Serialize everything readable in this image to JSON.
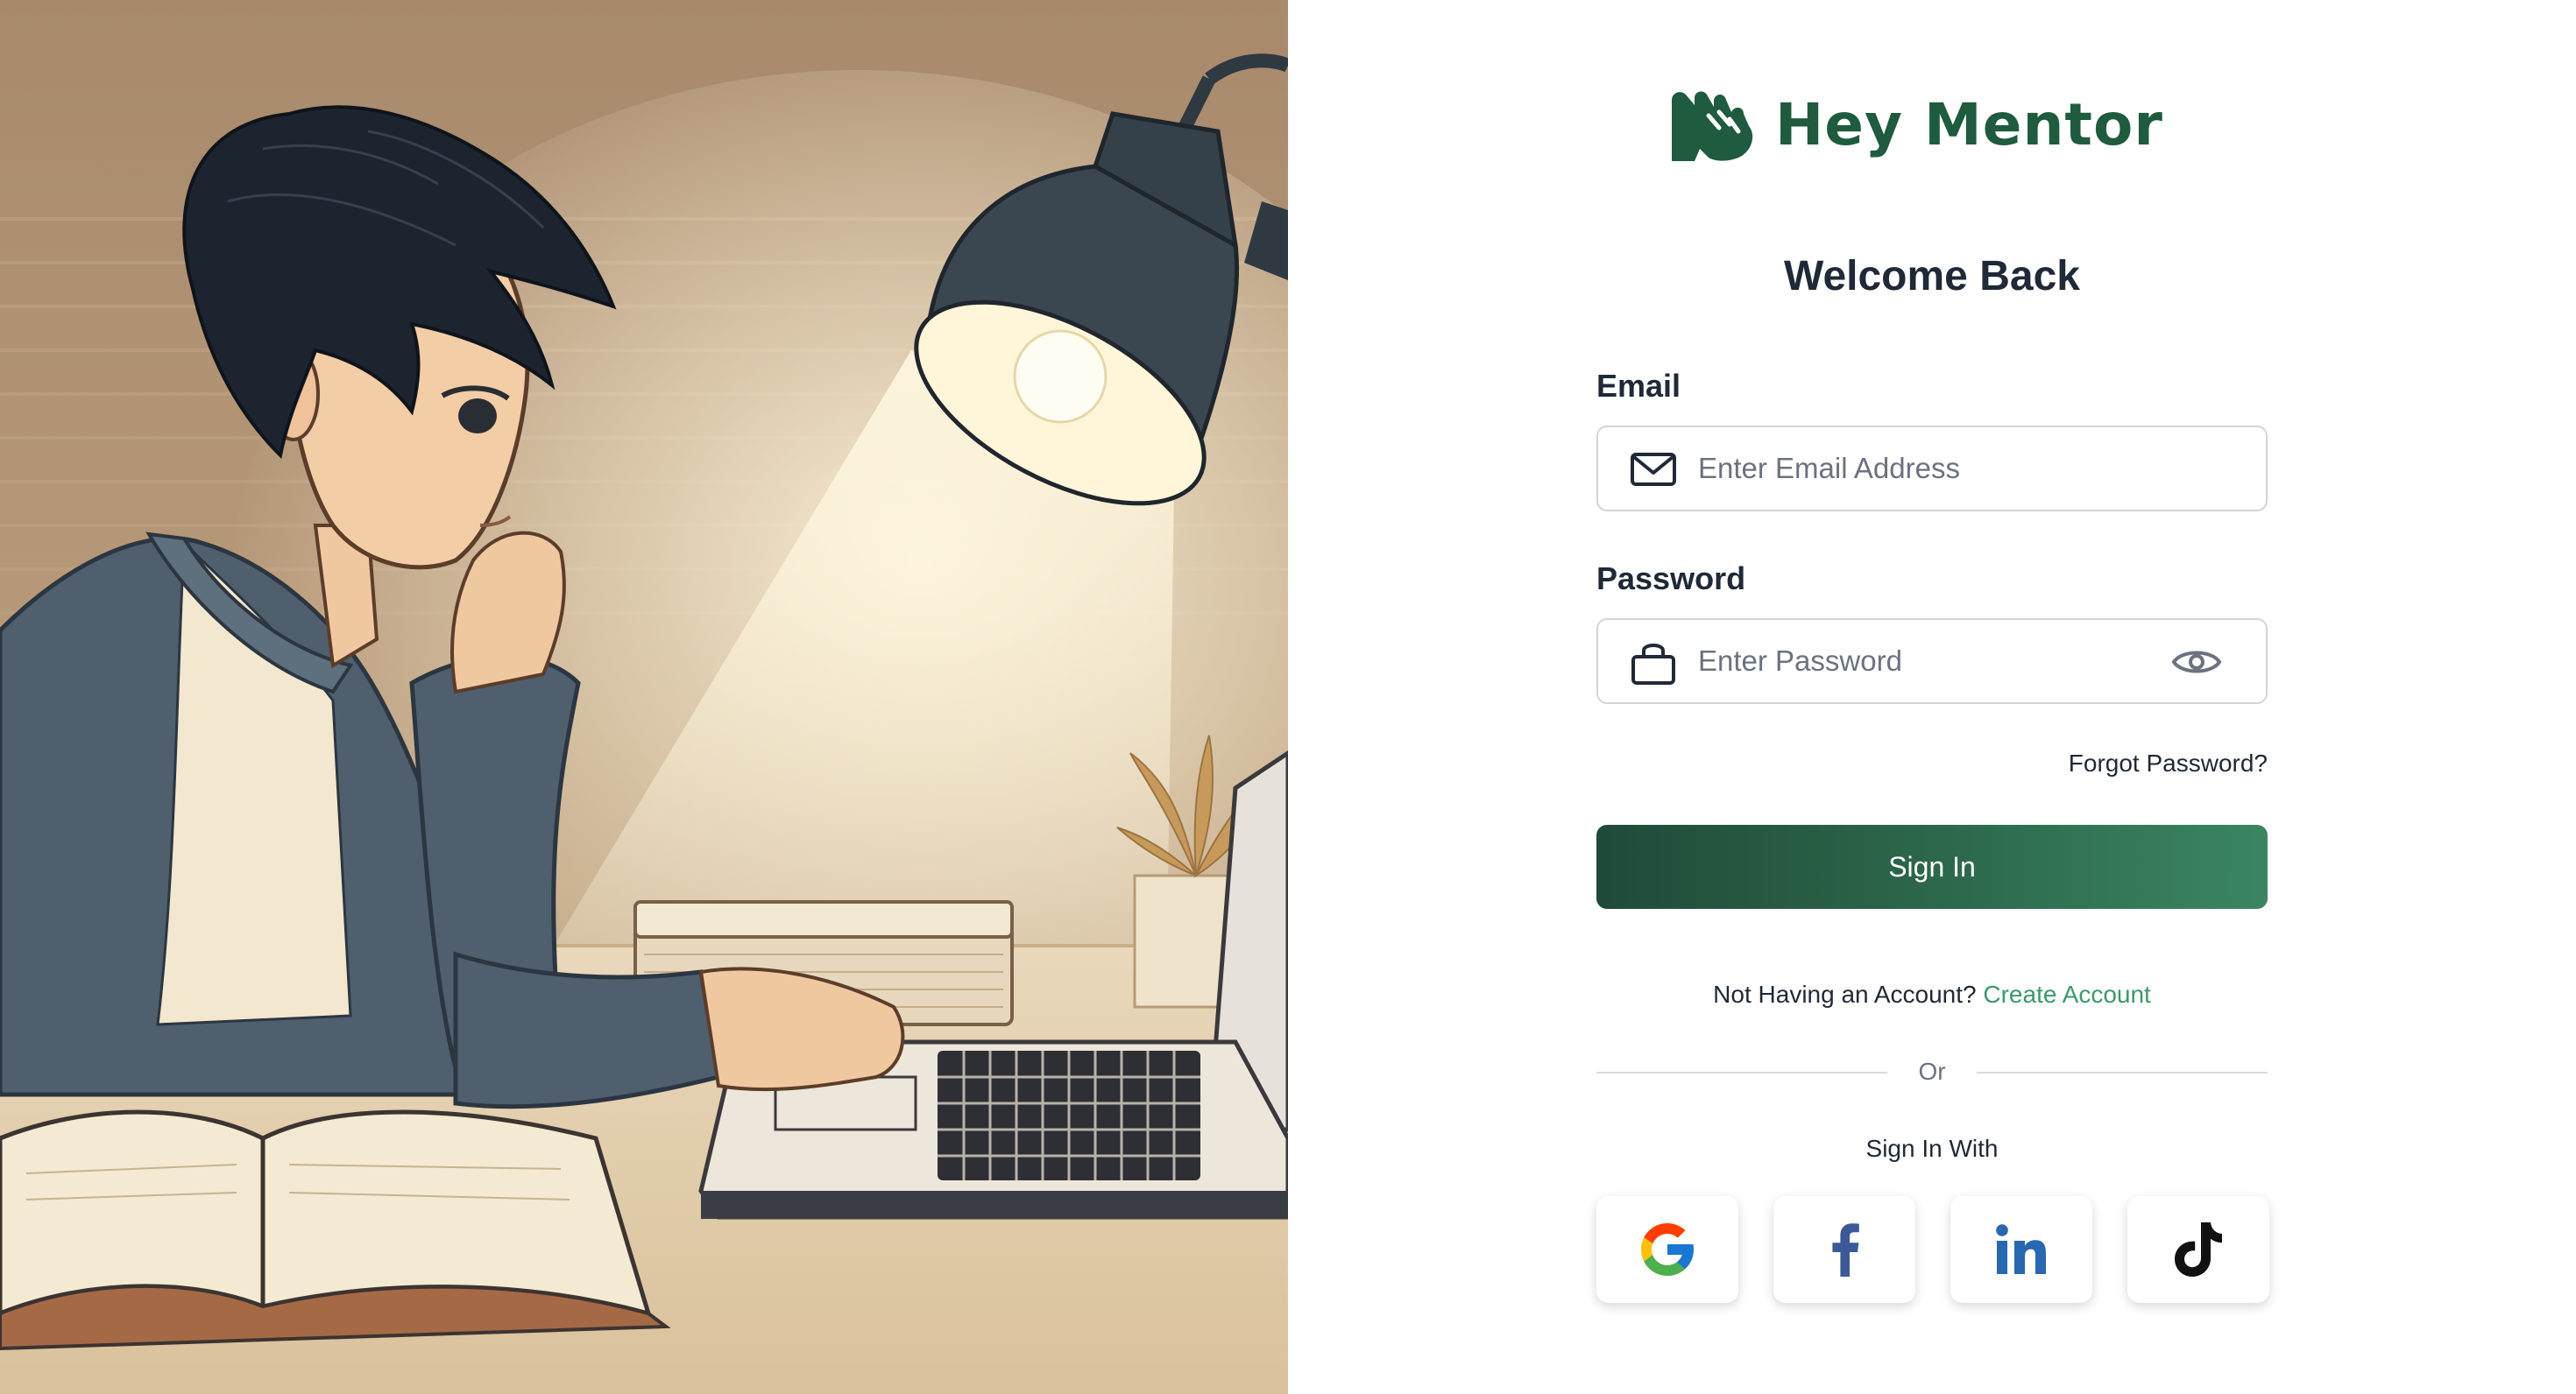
{
  "brand": {
    "name": "Hey Mentor",
    "color": "#1e5b3f",
    "icon": "hand-logo-icon"
  },
  "form": {
    "title": "Welcome Back",
    "email": {
      "label": "Email",
      "placeholder": "Enter Email Address",
      "value": "",
      "icon": "mail-icon"
    },
    "password": {
      "label": "Password",
      "placeholder": "Enter Password",
      "value": "",
      "icon": "lock-icon",
      "toggle_icon": "eye-icon"
    },
    "forgot_label": "Forgot Password?",
    "submit_label": "Sign In",
    "account_prompt": "Not Having an Account?",
    "create_account_label": "Create Account",
    "divider_label": "Or",
    "social_heading": "Sign In With"
  },
  "social": [
    {
      "name": "google",
      "icon": "google-icon"
    },
    {
      "name": "facebook",
      "icon": "facebook-icon"
    },
    {
      "name": "linkedin",
      "icon": "linkedin-icon"
    },
    {
      "name": "tiktok",
      "icon": "tiktok-icon"
    }
  ],
  "colors": {
    "primary": "#2d6a4d",
    "link": "#3a9a6a",
    "border": "#d4d4d8"
  }
}
